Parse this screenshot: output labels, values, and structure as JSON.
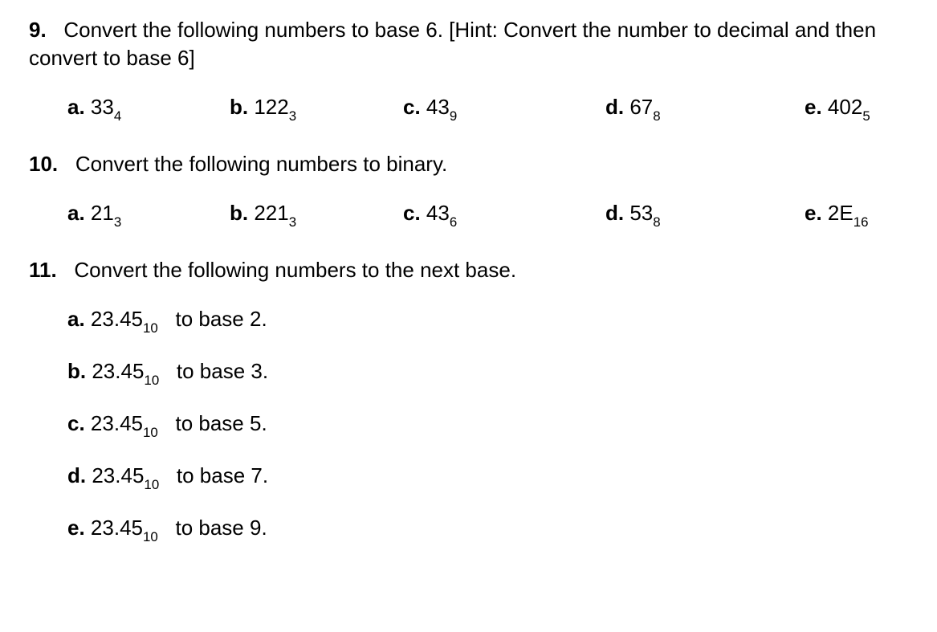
{
  "q9": {
    "num": "9.",
    "text": "Convert the following numbers to base 6. [Hint: Convert the number to decimal and then convert to base 6]",
    "options": [
      {
        "label": "a.",
        "value": "33",
        "sub": "4"
      },
      {
        "label": "b.",
        "value": "122",
        "sub": "3"
      },
      {
        "label": "c.",
        "value": "43",
        "sub": "9"
      },
      {
        "label": "d.",
        "value": "67",
        "sub": "8"
      },
      {
        "label": "e.",
        "value": "402",
        "sub": "5"
      }
    ]
  },
  "q10": {
    "num": "10.",
    "text": "Convert the following numbers to binary.",
    "options": [
      {
        "label": "a.",
        "value": "21",
        "sub": "3"
      },
      {
        "label": "b.",
        "value": "221",
        "sub": "3"
      },
      {
        "label": "c.",
        "value": "43",
        "sub": "6"
      },
      {
        "label": "d.",
        "value": "53",
        "sub": "8"
      },
      {
        "label": "e.",
        "value": "2E",
        "sub": "16"
      }
    ]
  },
  "q11": {
    "num": "11.",
    "text": "Convert the following numbers to the next base.",
    "options": [
      {
        "label": "a.",
        "value": "23.45",
        "sub": "10",
        "suffix": "to base 2."
      },
      {
        "label": "b.",
        "value": "23.45",
        "sub": "10",
        "suffix": "to base 3."
      },
      {
        "label": "c.",
        "value": "23.45",
        "sub": "10",
        "suffix": "to base 5."
      },
      {
        "label": "d.",
        "value": "23.45",
        "sub": "10",
        "suffix": "to base 7."
      },
      {
        "label": "e.",
        "value": "23.45",
        "sub": "10",
        "suffix": "to base 9."
      }
    ]
  }
}
